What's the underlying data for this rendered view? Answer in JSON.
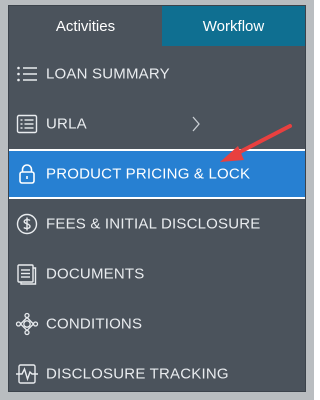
{
  "tabs": [
    {
      "label": "Activities",
      "active": true
    },
    {
      "label": "Workflow",
      "active": false
    }
  ],
  "menu": [
    {
      "label": "LOAN SUMMARY",
      "icon": "list-icon"
    },
    {
      "label": "URLA",
      "icon": "form-list-icon",
      "has_submenu": true
    },
    {
      "label": "PRODUCT PRICING & LOCK",
      "icon": "lock-icon",
      "active": true
    },
    {
      "label": "FEES & INITIAL DISCLOSURE",
      "icon": "dollar-circle-icon"
    },
    {
      "label": "DOCUMENTS",
      "icon": "documents-icon"
    },
    {
      "label": "CONDITIONS",
      "icon": "conditions-icon"
    },
    {
      "label": "DISCLOSURE TRACKING",
      "icon": "tracking-icon"
    }
  ],
  "colors": {
    "panel": "#4b535c",
    "workflow_tab": "#0f6f91",
    "active_item": "#2780d2",
    "annotation_arrow": "#e8403f"
  }
}
